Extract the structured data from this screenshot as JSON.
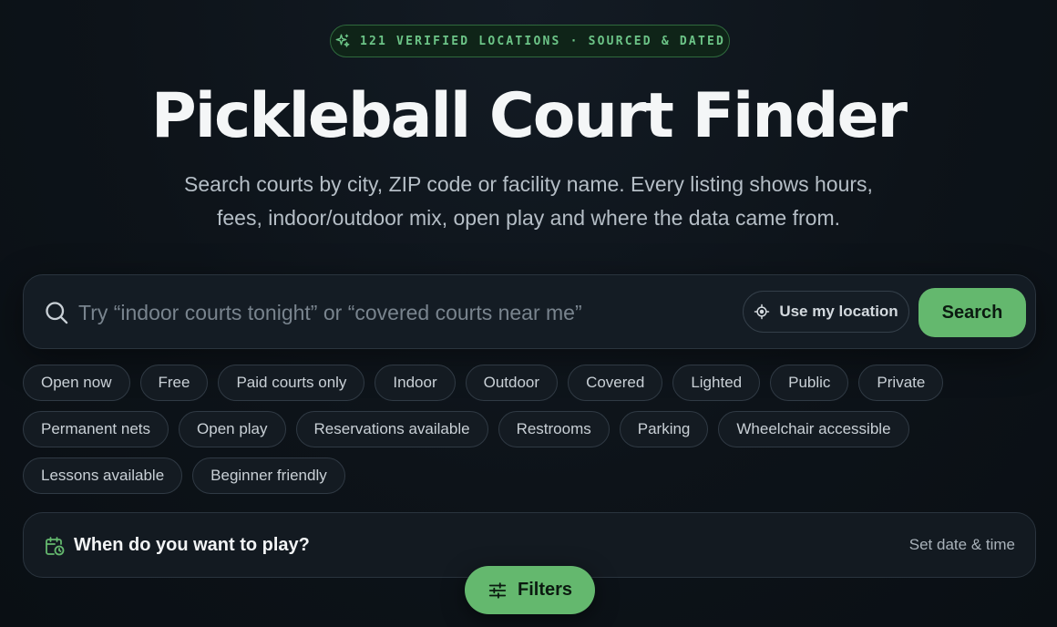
{
  "badge": {
    "icon": "sparkle-icon",
    "text": "121 VERIFIED LOCATIONS · SOURCED & DATED"
  },
  "hero": {
    "title": "Pickleball Court Finder",
    "subtitle": "Search courts by city, ZIP code or facility name. Every listing shows hours, fees, indoor/outdoor mix, open play and where the data came from."
  },
  "search": {
    "placeholder": "Try “indoor courts tonight” or “covered courts near me”",
    "value": "",
    "location_label": "Use my location",
    "button_label": "Search"
  },
  "filters": [
    {
      "label": "Open now",
      "name": "filter-open-now"
    },
    {
      "label": "Free",
      "name": "filter-free"
    },
    {
      "label": "Paid courts only",
      "name": "filter-paid-courts-only"
    },
    {
      "label": "Indoor",
      "name": "filter-indoor"
    },
    {
      "label": "Outdoor",
      "name": "filter-outdoor"
    },
    {
      "label": "Covered",
      "name": "filter-covered"
    },
    {
      "label": "Lighted",
      "name": "filter-lighted"
    },
    {
      "label": "Public",
      "name": "filter-public"
    },
    {
      "label": "Private",
      "name": "filter-private"
    },
    {
      "label": "Permanent nets",
      "name": "filter-permanent-nets"
    },
    {
      "label": "Open play",
      "name": "filter-open-play"
    },
    {
      "label": "Reservations available",
      "name": "filter-reservations-available"
    },
    {
      "label": "Restrooms",
      "name": "filter-restrooms"
    },
    {
      "label": "Parking",
      "name": "filter-parking"
    },
    {
      "label": "Wheelchair accessible",
      "name": "filter-wheelchair-accessible"
    },
    {
      "label": "Lessons available",
      "name": "filter-lessons-available"
    },
    {
      "label": "Beginner friendly",
      "name": "filter-beginner-friendly"
    }
  ],
  "when": {
    "icon": "calendar-clock-icon",
    "title": "When do you want to play?",
    "action_label": "Set date & time"
  },
  "filters_button": {
    "icon": "sliders-icon",
    "label": "Filters"
  },
  "colors": {
    "accent": "#64b86e",
    "accent_text": "#6cc487",
    "background": "#0d1319"
  }
}
